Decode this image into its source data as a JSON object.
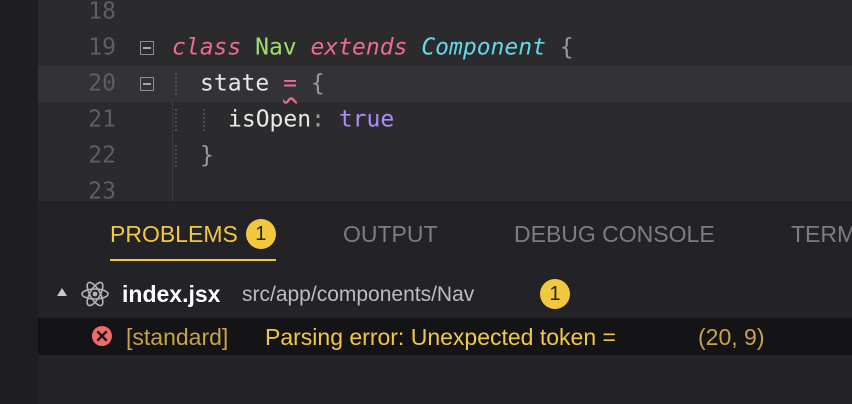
{
  "editor": {
    "lines": [
      {
        "number": "18"
      },
      {
        "number": "19",
        "tokens": {
          "kw_class": "class",
          "name": "Nav",
          "kw_extends": "extends",
          "base": "Component",
          "brace": "{"
        }
      },
      {
        "number": "20",
        "tokens": {
          "prop": "state",
          "op": "=",
          "brace": "{"
        }
      },
      {
        "number": "21",
        "tokens": {
          "key": "isOpen",
          "colon": ":",
          "value": "true"
        }
      },
      {
        "number": "22",
        "tokens": {
          "brace": "}"
        }
      },
      {
        "number": "23"
      }
    ]
  },
  "panel": {
    "tabs": [
      {
        "label": "PROBLEMS",
        "badge": "1",
        "active": true
      },
      {
        "label": "OUTPUT"
      },
      {
        "label": "DEBUG CONSOLE"
      },
      {
        "label": "TERM"
      }
    ],
    "file": {
      "name": "index.jsx",
      "path": "src/app/components/Nav",
      "count": "1",
      "icon": "react-icon"
    },
    "problems": [
      {
        "icon": "error-icon",
        "source": "[standard]",
        "message": "Parsing error: Unexpected token =",
        "location": "(20, 9)"
      }
    ]
  },
  "colors": {
    "accent": "#f2c840",
    "error": "#f06a6a",
    "keyword": "#f06a91",
    "class_name": "#9ee06c",
    "type_name": "#65d7e6",
    "boolean": "#ac8dff"
  }
}
